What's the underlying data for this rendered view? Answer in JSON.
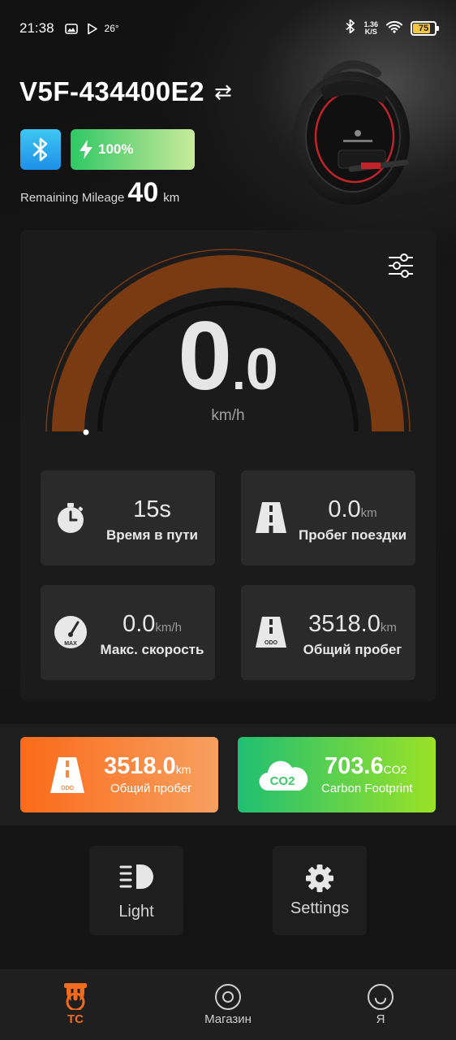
{
  "status_bar": {
    "time": "21:38",
    "temperature": "26°",
    "net_speed_value": "1.36",
    "net_speed_unit": "K/S",
    "battery_level": "75"
  },
  "device": {
    "name": "V5F-434400E2",
    "battery_percent": "100%",
    "remaining_mileage_label": "Remaining Mileage",
    "remaining_mileage_value": "40",
    "remaining_mileage_unit": "km"
  },
  "speedometer": {
    "integer": "0",
    "decimal": "0",
    "unit": "km/h",
    "gauge_level": 0
  },
  "stats": [
    {
      "value": "15s",
      "unit": "",
      "label": "Время в пути",
      "icon": "stopwatch-icon"
    },
    {
      "value": "0.0",
      "unit": "km",
      "label": "Пробег поездки",
      "icon": "road-icon"
    },
    {
      "value": "0.0",
      "unit": "km/h",
      "label": "Макс. скорость",
      "icon": "max-speed-gauge-icon",
      "icon_text": "MAX"
    },
    {
      "value": "3518.0",
      "unit": "km",
      "label": "Общий пробег",
      "icon": "odometer-road-icon",
      "icon_text": "ODO"
    }
  ],
  "promo_cards": {
    "odo": {
      "value": "3518.0",
      "unit": "km",
      "label": "Общий пробег",
      "icon_text": "ODO",
      "color_start": "#fb6a19",
      "color_end": "#f6a060"
    },
    "co2": {
      "value": "703.6",
      "unit": "CO2",
      "label": "Carbon Footprint",
      "icon_text": "CO2",
      "color_start": "#1fbf72",
      "color_end": "#9be226"
    }
  },
  "actions": {
    "light_label": "Light",
    "settings_label": "Settings"
  },
  "nav": {
    "items": [
      {
        "label": "TC",
        "active": true,
        "icon": "vehicle-icon"
      },
      {
        "label": "Магазин",
        "active": false,
        "icon": "store-icon"
      },
      {
        "label": "Я",
        "active": false,
        "icon": "profile-icon"
      }
    ],
    "active_color": "#f26b1d"
  },
  "colors": {
    "gauge_arc": "#7a3b12",
    "accent_orange": "#f26b1d",
    "bluetooth": "#2aa6ee"
  }
}
